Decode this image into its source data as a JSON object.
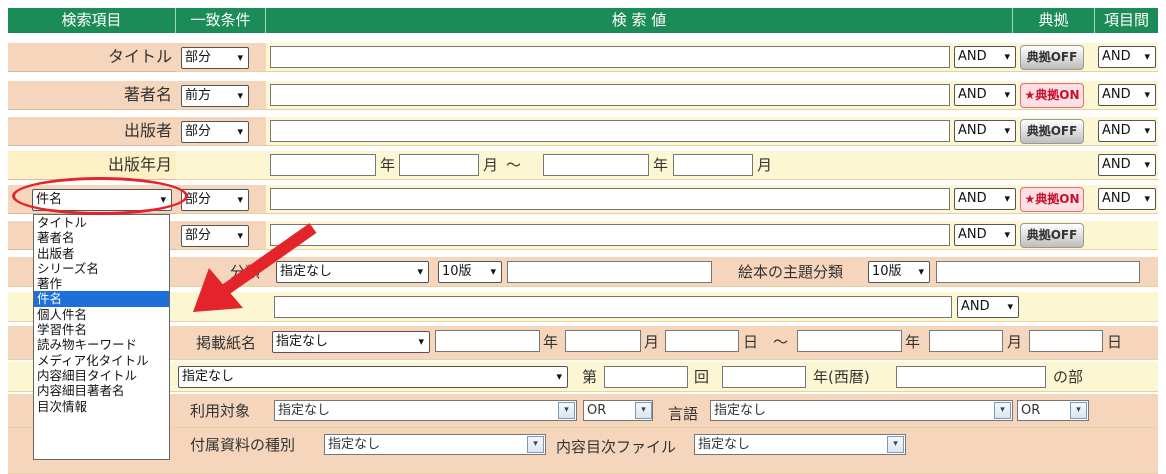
{
  "header": {
    "search_item": "検索項目",
    "match": "一致条件",
    "search_value": "検 索 値",
    "tenkyo": "典拠",
    "between": "項目間"
  },
  "rows": {
    "title": {
      "label": "タイトル",
      "match": "部分",
      "op": "AND",
      "tenkyo": "典拠OFF",
      "between": "AND"
    },
    "author": {
      "label": "著者名",
      "match": "前方",
      "op": "AND",
      "tenkyo": "★典拠ON",
      "between": "AND"
    },
    "publisher": {
      "label": "出版者",
      "match": "部分",
      "op": "AND",
      "tenkyo": "典拠OFF",
      "between": "AND"
    },
    "pubdate": {
      "label": "出版年月",
      "year": "年",
      "month": "月",
      "tilde": "〜",
      "year2": "年",
      "month2": "月",
      "between": "AND"
    },
    "subject": {
      "selected": "件名",
      "match": "部分",
      "op": "AND",
      "tenkyo": "★典拠ON",
      "between": "AND"
    },
    "row6": {
      "match": "部分",
      "op": "AND",
      "tenkyo": "典拠OFF"
    },
    "ndc": {
      "label_tail": "分類",
      "select": "指定なし",
      "edition": "10版",
      "picture_label": "絵本の主題分類",
      "edition2": "10版"
    },
    "row8": {
      "op": "AND"
    },
    "journal": {
      "label": "掲載紙名",
      "select": "指定なし",
      "year": "年",
      "month": "月",
      "day": "日",
      "tilde": "〜",
      "year2": "年",
      "month2": "月",
      "day2": "日"
    },
    "award": {
      "select": "指定なし",
      "dai": "第",
      "kai": "回",
      "year": "年(西暦)",
      "bu": "の部"
    },
    "target": {
      "label": "利用対象",
      "select": "指定なし",
      "op": "OR",
      "lang_label": "言語",
      "lang_select": "指定なし",
      "lang_op": "OR"
    },
    "attach": {
      "label": "付属資料の種別",
      "select": "指定なし",
      "toc_label": "内容目次ファイル",
      "toc_select": "指定なし"
    }
  },
  "dropdown": {
    "options": [
      "タイトル",
      "著者名",
      "出版者",
      "シリーズ名",
      "著作",
      "件名",
      "個人件名",
      "学習件名",
      "読み物キーワード",
      "メディア化タイトル",
      "内容細目タイトル",
      "内容細目著者名",
      "目次情報"
    ],
    "highlighted": 5
  },
  "arrow_symbol": "▾",
  "colors": {
    "header_green": "#1b8b58",
    "label_peach": "#f5d6bc",
    "value_cream": "#fdf6d2",
    "highlight_red": "#e3242b",
    "selection_blue": "#1e6fd8"
  }
}
